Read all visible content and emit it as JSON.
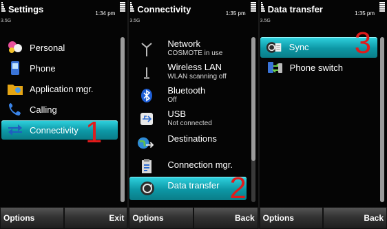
{
  "screen1": {
    "title": "Settings",
    "time": "1:34 pm",
    "signal_label": "3.5G",
    "items": [
      {
        "label": "Personal",
        "icon": "personal-icon"
      },
      {
        "label": "Phone",
        "icon": "phone-icon"
      },
      {
        "label": "Application mgr.",
        "icon": "folder-icon"
      },
      {
        "label": "Calling",
        "icon": "handset-icon"
      },
      {
        "label": "Connectivity",
        "icon": "connectivity-arrows-icon",
        "selected": true
      }
    ],
    "softkeys": {
      "left": "Options",
      "right": "Exit"
    },
    "annotation": "1"
  },
  "screen2": {
    "title": "Connectivity",
    "time": "1:35 pm",
    "signal_label": "3.5G",
    "items": [
      {
        "label": "Network",
        "sub": "COSMOTE in use",
        "icon": "antenna-icon"
      },
      {
        "label": "Wireless LAN",
        "sub": "WLAN scanning off",
        "icon": "wlan-icon"
      },
      {
        "label": "Bluetooth",
        "sub": "Off",
        "icon": "bluetooth-icon"
      },
      {
        "label": "USB",
        "sub": "Not connected",
        "icon": "usb-icon"
      },
      {
        "label": "Destinations",
        "sub": "",
        "icon": "globe-icon"
      },
      {
        "label": "Connection mgr.",
        "sub": "",
        "icon": "connection-manager-icon"
      },
      {
        "label": "Data transfer",
        "sub": "",
        "icon": "data-transfer-icon",
        "selected": true
      }
    ],
    "softkeys": {
      "left": "Options",
      "right": "Back"
    },
    "annotation": "2"
  },
  "screen3": {
    "title": "Data transfer",
    "time": "1:35 pm",
    "signal_label": "3.5G",
    "items": [
      {
        "label": "Sync",
        "icon": "sync-icon",
        "selected": true
      },
      {
        "label": "Phone switch",
        "icon": "phone-switch-icon"
      }
    ],
    "softkeys": {
      "left": "Options",
      "right": "Back"
    },
    "annotation": "3"
  },
  "colors": {
    "highlight": "#12b3c2",
    "annotation": "#e01b1b",
    "background": "#050505"
  }
}
